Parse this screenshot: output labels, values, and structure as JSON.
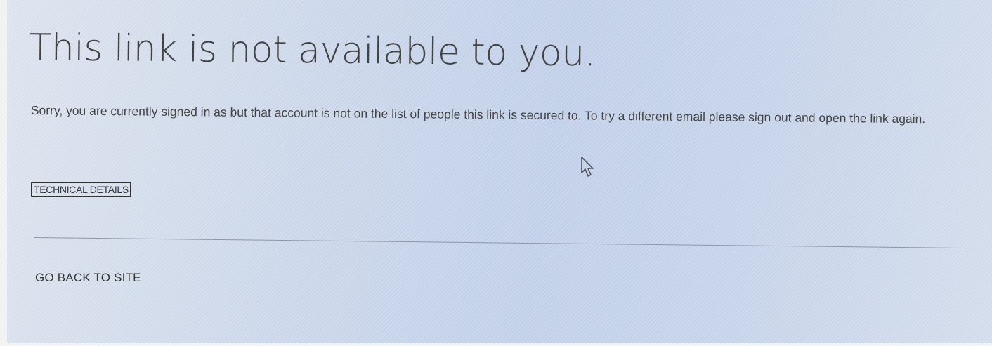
{
  "error_page": {
    "title": "This link is not available to you.",
    "message": "Sorry, you are currently signed in as  but that account is not on the list of people this link is secured to. To try a different email please sign out and open the link again.",
    "technical_details_label": "TECHNICAL DETAILS",
    "go_back_label": "GO BACK TO SITE"
  },
  "pointer": {
    "icon": "mouse-pointer-icon"
  }
}
